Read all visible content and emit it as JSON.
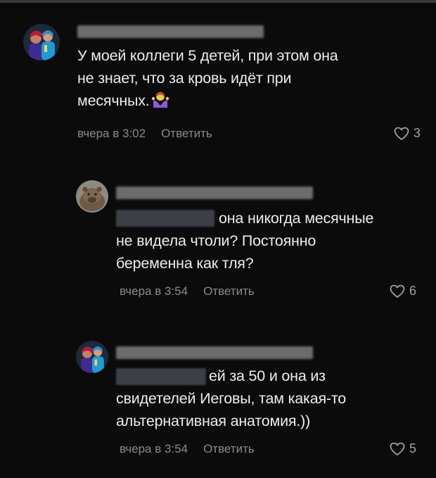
{
  "comments": [
    {
      "avatar_icon": "avatar-two-people-icon",
      "lines": [
        "У моей коллеги 5 детей, при этом она",
        "не знает, что за кровь идёт при",
        "месячных."
      ],
      "emoji": "🤷‍♀️",
      "time": "вчера в 3:02",
      "reply_label": "Ответить",
      "likes": "3"
    },
    {
      "avatar_icon": "avatar-capybara-icon",
      "lines": [
        "она никогда месячные",
        "не видела чтоли? Постоянно",
        "беременна как тля?"
      ],
      "time": "вчера в 3:54",
      "reply_label": "Ответить",
      "likes": "6"
    },
    {
      "avatar_icon": "avatar-two-people-icon",
      "lines": [
        "ей за 50 и она из",
        "свидетелей Иеговы, там какая-то",
        "альтернативная анатомия.))"
      ],
      "time": "вчера в 3:54",
      "reply_label": "Ответить",
      "likes": "5"
    }
  ],
  "colors": {
    "background": "#0b0b0b",
    "text": "#ececec",
    "meta": "#8a8a8a"
  }
}
